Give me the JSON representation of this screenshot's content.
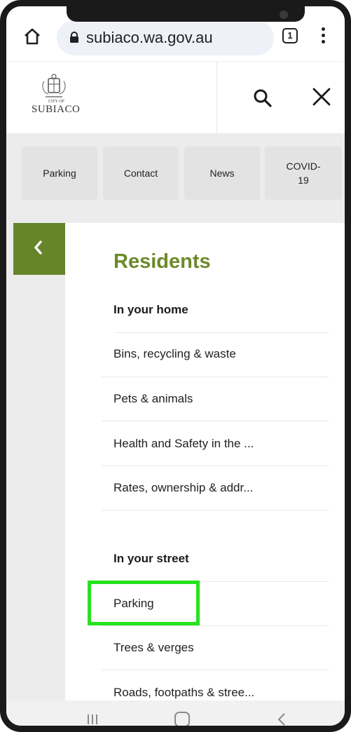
{
  "browser": {
    "url": "subiaco.wa.gov.au",
    "tab_count": "1"
  },
  "site": {
    "logo_text": "SUBIACO",
    "logo_city": "CITY OF"
  },
  "quick_links": [
    "Parking",
    "Contact",
    "News",
    "COVID-\n19"
  ],
  "menu": {
    "title": "Residents",
    "groups": [
      {
        "heading": "In your home",
        "items": [
          "Bins, recycling & waste",
          "Pets & animals",
          "Health and Safety in the ...",
          "Rates, ownership & addr..."
        ]
      },
      {
        "heading": "In your street",
        "items": [
          "Parking",
          "Trees & verges",
          "Roads, footpaths & stree..."
        ]
      }
    ]
  },
  "colors": {
    "accent_green": "#6b8a2a",
    "back_button": "#66852b",
    "highlight": "#27e21f"
  },
  "icons": [
    "home-icon",
    "lock-icon",
    "tab-count-icon",
    "more-vert-icon",
    "search-icon",
    "close-icon",
    "chevron-left-icon",
    "recent-apps-icon",
    "home-circle-icon",
    "nav-back-icon"
  ]
}
